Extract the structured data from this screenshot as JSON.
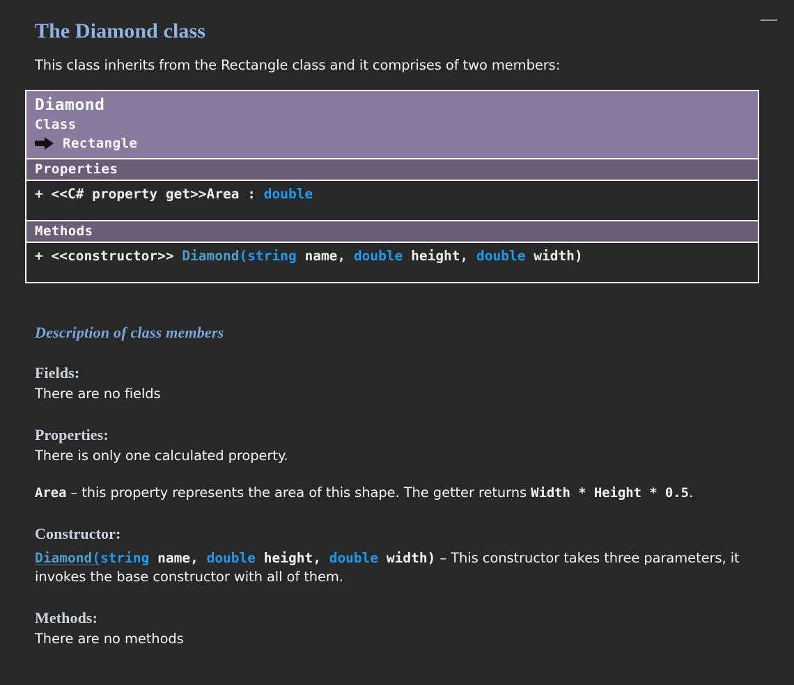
{
  "document": {
    "title": "The Diamond class",
    "intro": "This class inherits from the Rectangle class and it comprises of two members:"
  },
  "uml": {
    "class_name": "Diamond",
    "stereotype": "Class",
    "inherits_icon": "arrow-right-icon",
    "inherits_from": "Rectangle",
    "properties_header": "Properties",
    "properties": [
      {
        "prefix": "+ <<C# property get>>Area : ",
        "type": "double"
      }
    ],
    "methods_header": "Methods",
    "methods": [
      {
        "visibility": "+ <<constructor>> ",
        "name": "Diamond",
        "open_paren": "(",
        "params": [
          {
            "type": "string",
            "name": " name, "
          },
          {
            "type": "double",
            "name": " height, "
          },
          {
            "type": "double",
            "name": " width"
          }
        ],
        "close_paren": ")"
      }
    ],
    "colors": {
      "header_bg": "#8a7a9e",
      "section_bg": "#6b5c78",
      "body_bg": "#282828",
      "border": "#ffffff",
      "type_blue": "#1e9bf0",
      "class_teal": "#4d9fcc"
    }
  },
  "description": {
    "section_title": "Description of class members",
    "fields_heading": "Fields:",
    "fields_text": "There are no fields",
    "properties_heading": "Properties:",
    "properties_text": "There is only one calculated property.",
    "area_name": "Area",
    "area_desc_before": " – this property represents the area of this shape. The getter returns ",
    "area_expression": "Width * Height * 0.5",
    "area_desc_after": ".",
    "constructor_heading": "Constructor:",
    "ctor_name": "Diamond",
    "ctor_open_paren": "(",
    "ctor_params": [
      {
        "type": "string",
        "name": " name, "
      },
      {
        "type": "double",
        "name": " height, "
      },
      {
        "type": "double",
        "name": " width"
      }
    ],
    "ctor_close_paren": ")",
    "ctor_desc": " – This constructor takes three parameters, it invokes the base constructor with all of them.",
    "methods_heading": "Methods:",
    "methods_text": "There are no methods"
  },
  "colors": {
    "page_bg": "#282828",
    "title_blue": "#8fb3e0",
    "heading_grey": "#cbd2de",
    "body_white": "#f4f4f4",
    "guide_grey": "#9a9a9a"
  }
}
